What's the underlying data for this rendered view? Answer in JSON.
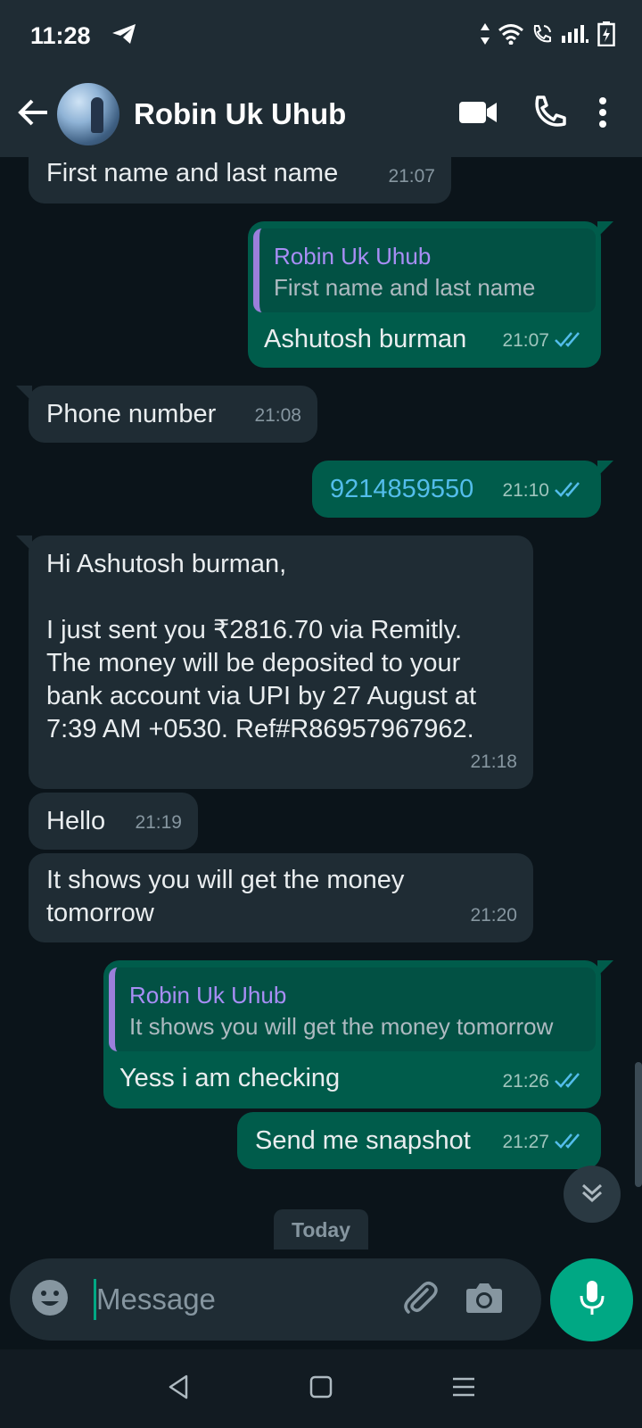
{
  "status_bar": {
    "time": "11:28"
  },
  "header": {
    "contact_name": "Robin Uk Uhub"
  },
  "messages": [
    {
      "dir": "in",
      "text": "First name and last name",
      "time": "21:07"
    },
    {
      "dir": "out",
      "quote_name": "Robin Uk Uhub",
      "quote_text": "First name and last name",
      "text": "Ashutosh burman",
      "time": "21:07"
    },
    {
      "dir": "in",
      "text": "Phone number",
      "time": "21:08"
    },
    {
      "dir": "out",
      "text": "9214859550",
      "time": "21:10"
    },
    {
      "dir": "in",
      "lines": [
        "Hi Ashutosh burman,",
        "",
        "I just sent you ₹2816.70 via Remitly.",
        "The money will be deposited to your",
        "bank account via UPI by 27 August at",
        "7:39 AM +0530. Ref#R86957967962."
      ],
      "time": "21:18"
    },
    {
      "dir": "in",
      "text": "Hello",
      "time": "21:19"
    },
    {
      "dir": "in",
      "lines": [
        "It shows you will get the money",
        "tomorrow"
      ],
      "time": "21:20"
    },
    {
      "dir": "out",
      "quote_name": "Robin Uk Uhub",
      "quote_text": "It shows you will get the money tomorrow",
      "text": "Yess i am checking",
      "time": "21:26"
    },
    {
      "dir": "out",
      "text": "Send me snapshot",
      "time": "21:27"
    }
  ],
  "date_chip": "Today",
  "compose": {
    "placeholder": "Message"
  },
  "colors": {
    "accent": "#00a884",
    "outgoing_bubble": "#005c4b",
    "incoming_bubble": "#1f2c34",
    "read_ticks": "#53bdeb",
    "quote_name": "#a88ef5"
  },
  "icons": [
    "telegram-icon",
    "data-arrows-icon",
    "wifi-icon",
    "wifi-call-icon",
    "signal-icon",
    "battery-icon",
    "back-arrow-icon",
    "video-call-icon",
    "voice-call-icon",
    "more-options-icon",
    "double-check-icon",
    "chevron-double-down-icon",
    "emoji-icon",
    "paperclip-icon",
    "camera-icon",
    "mic-icon",
    "nav-back-icon",
    "nav-home-icon",
    "nav-recents-icon"
  ]
}
